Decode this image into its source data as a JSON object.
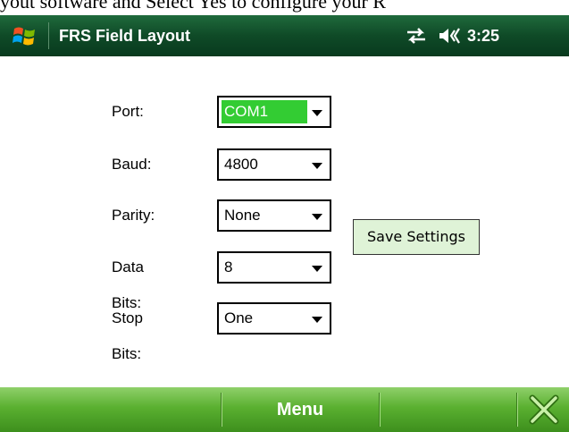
{
  "doc_bleed_text": "yout software and Select Yes to configure your R",
  "titlebar": {
    "title": "FRS Field Layout",
    "time": "3:25",
    "icons": [
      "windows-start-icon",
      "connectivity-icon",
      "volume-icon"
    ]
  },
  "form": {
    "port": {
      "label": "Port:",
      "value": "COM1"
    },
    "baud": {
      "label": "Baud:",
      "value": "4800"
    },
    "parity": {
      "label": "Parity:",
      "value": "None"
    },
    "data_bits": {
      "label": "Data Bits:",
      "value": "8"
    },
    "stop_bits": {
      "label": "Stop Bits:",
      "value": "One"
    },
    "save_label": "Save Settings"
  },
  "softkeys": {
    "menu_label": "Menu",
    "close_icon": "close-icon"
  },
  "colors": {
    "titlebar": "#0f4a27",
    "softbar": "#5ab030",
    "selection": "#33cc33",
    "button_bg": "#dff3d7"
  }
}
